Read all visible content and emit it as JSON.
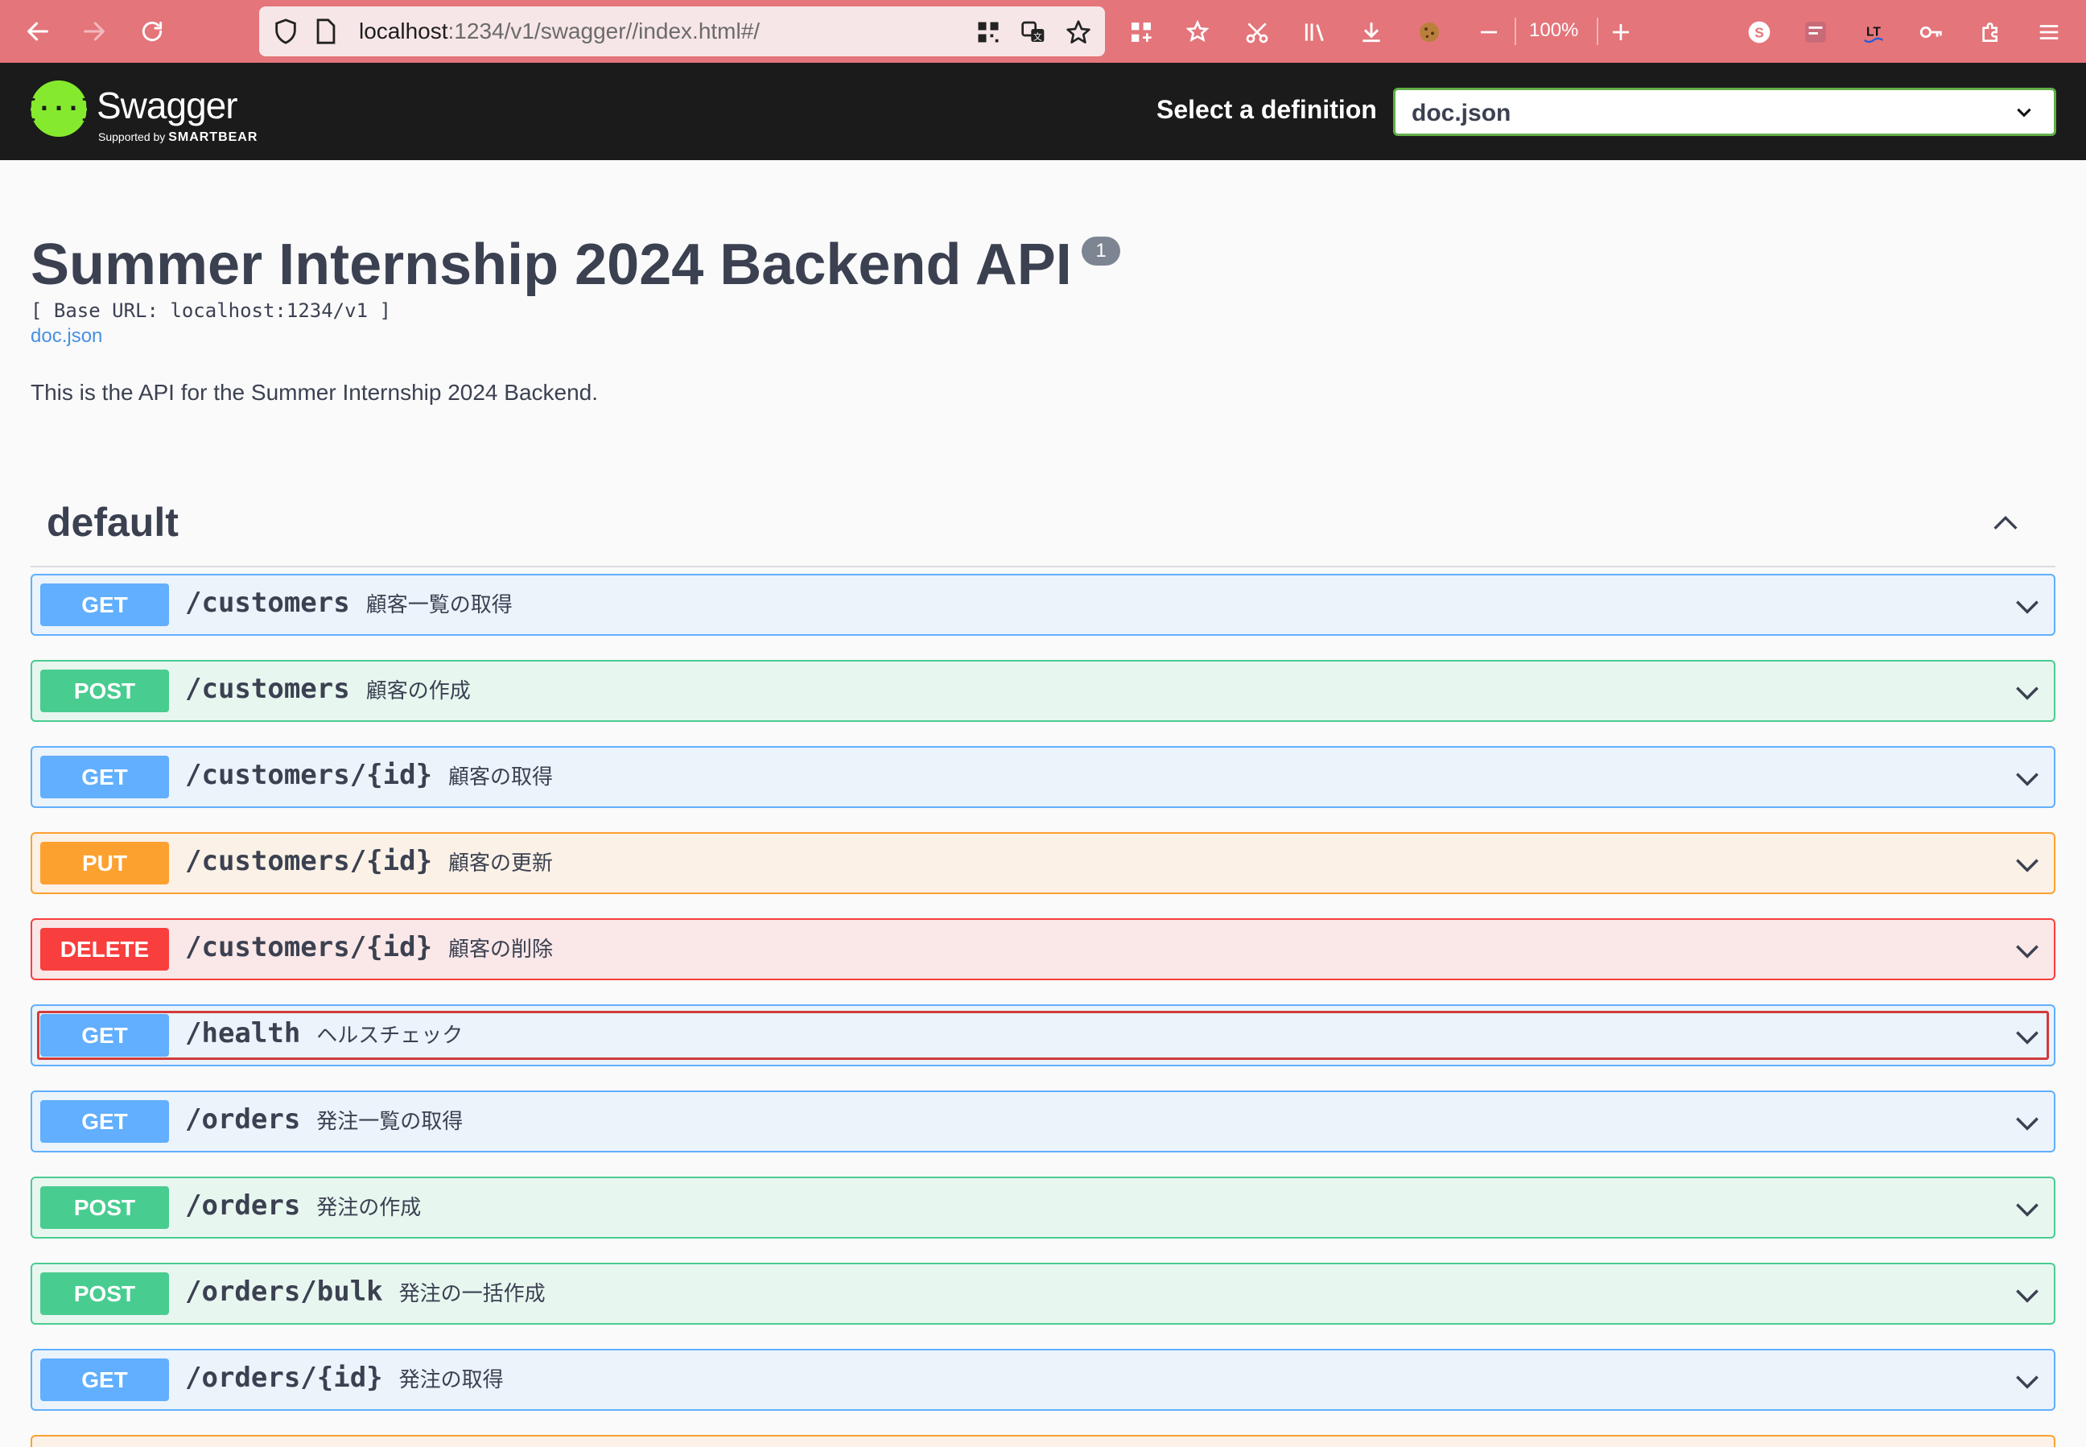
{
  "browser": {
    "url_host": "localhost",
    "url_path": ":1234/v1/swagger//index.html#/",
    "zoom": "100%"
  },
  "swagger": {
    "logo_word": "Swagger",
    "logo_supported": "Supported by",
    "logo_brand": "SMARTBEAR",
    "definition_label": "Select a definition",
    "definition_value": "doc.json"
  },
  "info": {
    "title": "Summer Internship 2024 Backend API",
    "version": "1",
    "base_url": "[ Base URL: localhost:1234/v1 ]",
    "doc_link": "doc.json",
    "description": "This is the API for the Summer Internship 2024 Backend."
  },
  "tag": {
    "name": "default"
  },
  "operations": [
    {
      "method": "GET",
      "path": "/customers",
      "summary": "顧客一覧の取得"
    },
    {
      "method": "POST",
      "path": "/customers",
      "summary": "顧客の作成"
    },
    {
      "method": "GET",
      "path": "/customers/{id}",
      "summary": "顧客の取得"
    },
    {
      "method": "PUT",
      "path": "/customers/{id}",
      "summary": "顧客の更新"
    },
    {
      "method": "DELETE",
      "path": "/customers/{id}",
      "summary": "顧客の削除"
    },
    {
      "method": "GET",
      "path": "/health",
      "summary": "ヘルスチェック"
    },
    {
      "method": "GET",
      "path": "/orders",
      "summary": "発注一覧の取得"
    },
    {
      "method": "POST",
      "path": "/orders",
      "summary": "発注の作成"
    },
    {
      "method": "POST",
      "path": "/orders/bulk",
      "summary": "発注の一括作成"
    },
    {
      "method": "GET",
      "path": "/orders/{id}",
      "summary": "発注の取得"
    }
  ],
  "colors": {
    "get": "#61affe",
    "post": "#49cc90",
    "put": "#fca130",
    "delete": "#f93e3e",
    "brand": "#85ea2d"
  }
}
